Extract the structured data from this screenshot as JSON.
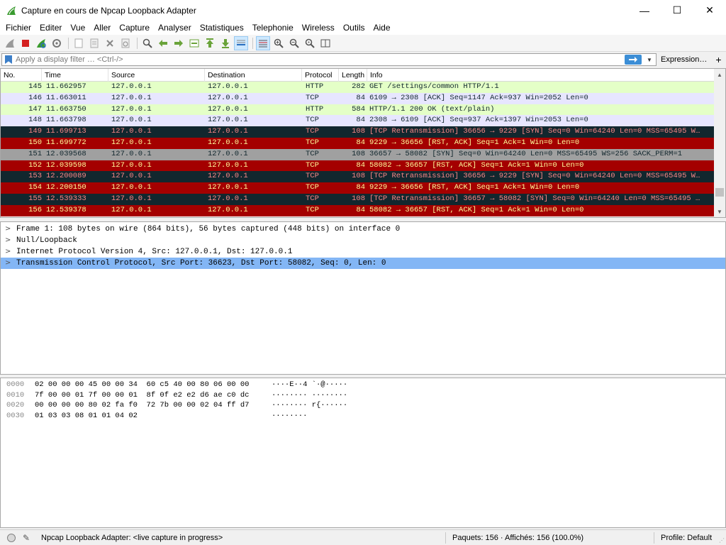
{
  "window": {
    "title": "Capture en cours de Npcap Loopback Adapter",
    "minimize": "—",
    "maximize": "☐",
    "close": "✕"
  },
  "menu": [
    "Fichier",
    "Editer",
    "Vue",
    "Aller",
    "Capture",
    "Analyser",
    "Statistiques",
    "Telephonie",
    "Wireless",
    "Outils",
    "Aide"
  ],
  "toolbar": {
    "icons": [
      "shark-fin-icon",
      "stop-icon",
      "restart-icon",
      "options-gear-icon",
      "open-file-icon",
      "save-file-icon",
      "close-file-icon",
      "reload-icon",
      "find-icon",
      "back-arrow-icon",
      "forward-arrow-icon",
      "goto-packet-icon",
      "first-packet-icon",
      "last-packet-icon",
      "autoscroll-icon",
      "colorize-icon",
      "zoom-in-icon",
      "zoom-out-icon",
      "zoom-normal-icon",
      "resize-columns-icon"
    ]
  },
  "filter": {
    "placeholder": "Apply a display filter … <Ctrl-/>",
    "expression_label": "Expression…",
    "plus": "+"
  },
  "packet_list": {
    "columns": [
      "No.",
      "Time",
      "Source",
      "Destination",
      "Protocol",
      "Length",
      "Info"
    ],
    "rows": [
      {
        "no": "145",
        "time": "11.662957",
        "src": "127.0.0.1",
        "dst": "127.0.0.1",
        "proto": "HTTP",
        "len": "282",
        "info": "GET /settings/common HTTP/1.1",
        "style": "http"
      },
      {
        "no": "146",
        "time": "11.663011",
        "src": "127.0.0.1",
        "dst": "127.0.0.1",
        "proto": "TCP",
        "len": "84",
        "info": "6109 → 2308 [ACK] Seq=1147 Ack=937 Win=2052 Len=0",
        "style": "tcp"
      },
      {
        "no": "147",
        "time": "11.663750",
        "src": "127.0.0.1",
        "dst": "127.0.0.1",
        "proto": "HTTP",
        "len": "584",
        "info": "HTTP/1.1 200 OK  (text/plain)",
        "style": "http"
      },
      {
        "no": "148",
        "time": "11.663798",
        "src": "127.0.0.1",
        "dst": "127.0.0.1",
        "proto": "TCP",
        "len": "84",
        "info": "2308 → 6109 [ACK] Seq=937 Ack=1397 Win=2053 Len=0",
        "style": "tcp"
      },
      {
        "no": "149",
        "time": "11.699713",
        "src": "127.0.0.1",
        "dst": "127.0.0.1",
        "proto": "TCP",
        "len": "108",
        "info": "[TCP Retransmission] 36656 → 9229 [SYN] Seq=0 Win=64240 Len=0 MSS=65495 W…",
        "style": "dark"
      },
      {
        "no": "150",
        "time": "11.699772",
        "src": "127.0.0.1",
        "dst": "127.0.0.1",
        "proto": "TCP",
        "len": "84",
        "info": "9229 → 36656 [RST, ACK] Seq=1 Ack=1 Win=0 Len=0",
        "style": "red"
      },
      {
        "no": "151",
        "time": "12.039568",
        "src": "127.0.0.1",
        "dst": "127.0.0.1",
        "proto": "TCP",
        "len": "108",
        "info": "36657 → 58082 [SYN] Seq=0 Win=64240 Len=0 MSS=65495 WS=256 SACK_PERM=1",
        "style": "gray"
      },
      {
        "no": "152",
        "time": "12.039598",
        "src": "127.0.0.1",
        "dst": "127.0.0.1",
        "proto": "TCP",
        "len": "84",
        "info": "58082 → 36657 [RST, ACK] Seq=1 Ack=1 Win=0 Len=0",
        "style": "red"
      },
      {
        "no": "153",
        "time": "12.200089",
        "src": "127.0.0.1",
        "dst": "127.0.0.1",
        "proto": "TCP",
        "len": "108",
        "info": "[TCP Retransmission] 36656 → 9229 [SYN] Seq=0 Win=64240 Len=0 MSS=65495 W…",
        "style": "dark"
      },
      {
        "no": "154",
        "time": "12.200150",
        "src": "127.0.0.1",
        "dst": "127.0.0.1",
        "proto": "TCP",
        "len": "84",
        "info": "9229 → 36656 [RST, ACK] Seq=1 Ack=1 Win=0 Len=0",
        "style": "red"
      },
      {
        "no": "155",
        "time": "12.539333",
        "src": "127.0.0.1",
        "dst": "127.0.0.1",
        "proto": "TCP",
        "len": "108",
        "info": "[TCP Retransmission] 36657 → 58082 [SYN] Seq=0 Win=64240 Len=0 MSS=65495 …",
        "style": "dark"
      },
      {
        "no": "156",
        "time": "12.539378",
        "src": "127.0.0.1",
        "dst": "127.0.0.1",
        "proto": "TCP",
        "len": "84",
        "info": "58082 → 36657 [RST, ACK] Seq=1 Ack=1 Win=0 Len=0",
        "style": "red"
      }
    ],
    "scroll_position": 0.92
  },
  "details": {
    "rows": [
      {
        "text": "Frame 1: 108 bytes on wire (864 bits), 56 bytes captured (448 bits) on interface 0",
        "selected": false
      },
      {
        "text": "Null/Loopback",
        "selected": false
      },
      {
        "text": "Internet Protocol Version 4, Src: 127.0.0.1, Dst: 127.0.0.1",
        "selected": false
      },
      {
        "text": "Transmission Control Protocol, Src Port: 36623, Dst Port: 58082, Seq: 0, Len: 0",
        "selected": true
      }
    ]
  },
  "bytes": {
    "rows": [
      {
        "offset": "0000",
        "hex": "02 00 00 00 45 00 00 34  60 c5 40 00 80 06 00 00",
        "ascii": "····E··4 `·@·····"
      },
      {
        "offset": "0010",
        "hex": "7f 00 00 01 7f 00 00 01  8f 0f e2 e2 d6 ae c0 dc",
        "ascii": "········ ········"
      },
      {
        "offset": "0020",
        "hex": "00 00 00 00 80 02 fa f0  72 7b 00 00 02 04 ff d7",
        "ascii": "········ r{······"
      },
      {
        "offset": "0030",
        "hex": "01 03 03 08 01 01 04 02",
        "ascii": "········"
      }
    ]
  },
  "status": {
    "message": "Npcap Loopback Adapter: <live capture in progress>",
    "packets": "Paquets: 156 · Affichés: 156 (100.0%)",
    "profile": "Profile: Default"
  }
}
